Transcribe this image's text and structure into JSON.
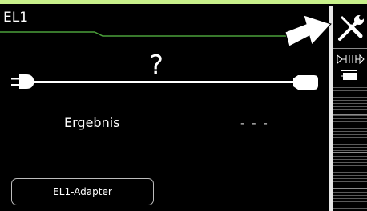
{
  "header": {
    "title": "EL1"
  },
  "status": {
    "unknown_symbol": "?"
  },
  "result": {
    "label": "Ergebnis",
    "value": "- - -"
  },
  "adapter": {
    "button_label": "EL1-Adapter"
  },
  "sidebar": {
    "icons": [
      "settings-tools-icon",
      "measurement-function-icon"
    ]
  },
  "colors": {
    "top_strip": "#c8f08a",
    "accent_line": "#4aa03a",
    "text": "#ffffff"
  }
}
